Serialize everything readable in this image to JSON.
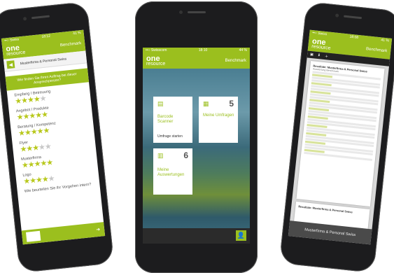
{
  "colors": {
    "accent": "#9bbf1e",
    "star": "#b8c81c",
    "dark": "#2b2b2b"
  },
  "phone1": {
    "status": {
      "carrier": "••○ Swiss",
      "time": "18:12",
      "battery": "41 %"
    },
    "appbar": {
      "logo_top": "one",
      "logo_bottom": "resource",
      "right": "Benchmark"
    },
    "subheader": {
      "title": "Musterfirma & Personal Swiss"
    },
    "band_text": "Wie finden Sie Ihren Auftrag bei dieser Ansprechperson?",
    "criteria": [
      {
        "label": "Empfang / Betreuung",
        "rating": 4
      },
      {
        "label": "Angebot / Produkte",
        "rating": 5
      },
      {
        "label": "Beratung / Kompetenz",
        "rating": 5
      },
      {
        "label": "Flyer",
        "rating": 3
      },
      {
        "label": "Musterfirma",
        "rating": 5
      },
      {
        "label": "Logo",
        "rating": 4
      }
    ],
    "last_label": "Wie beurteilen Sie Ihr Vorgehen intern?"
  },
  "phone2": {
    "status": {
      "carrier": "••○ Swisscom",
      "time": "18:10",
      "battery": "44 %"
    },
    "appbar": {
      "logo_top": "one",
      "logo_bottom": "resource",
      "right": "Benchmark"
    },
    "tiles": [
      {
        "icon": "barcode-icon",
        "label_line1": "Barcode",
        "label_line2": "Scanner",
        "button": "Umfrage starten",
        "number": ""
      },
      {
        "icon": "doc-icon",
        "label_line1": "Meine Umfragen",
        "label_line2": "",
        "button": "",
        "number": "5"
      },
      {
        "icon": "chart-icon",
        "label_line1": "Meine",
        "label_line2": "Auswertungen",
        "button": "",
        "number": "6"
      }
    ]
  },
  "phone3": {
    "status": {
      "carrier": "••○ Swiss",
      "time": "18:08",
      "battery": "41 %"
    },
    "appbar": {
      "logo_top": "one",
      "logo_bottom": "resource",
      "right": "Benchmark"
    },
    "report": {
      "title": "Resultate: Musterfirma & Personal Swiss",
      "subtitle": "Auswertung Benchmark"
    },
    "footer": "Musterfirma & Personal Swiss"
  }
}
